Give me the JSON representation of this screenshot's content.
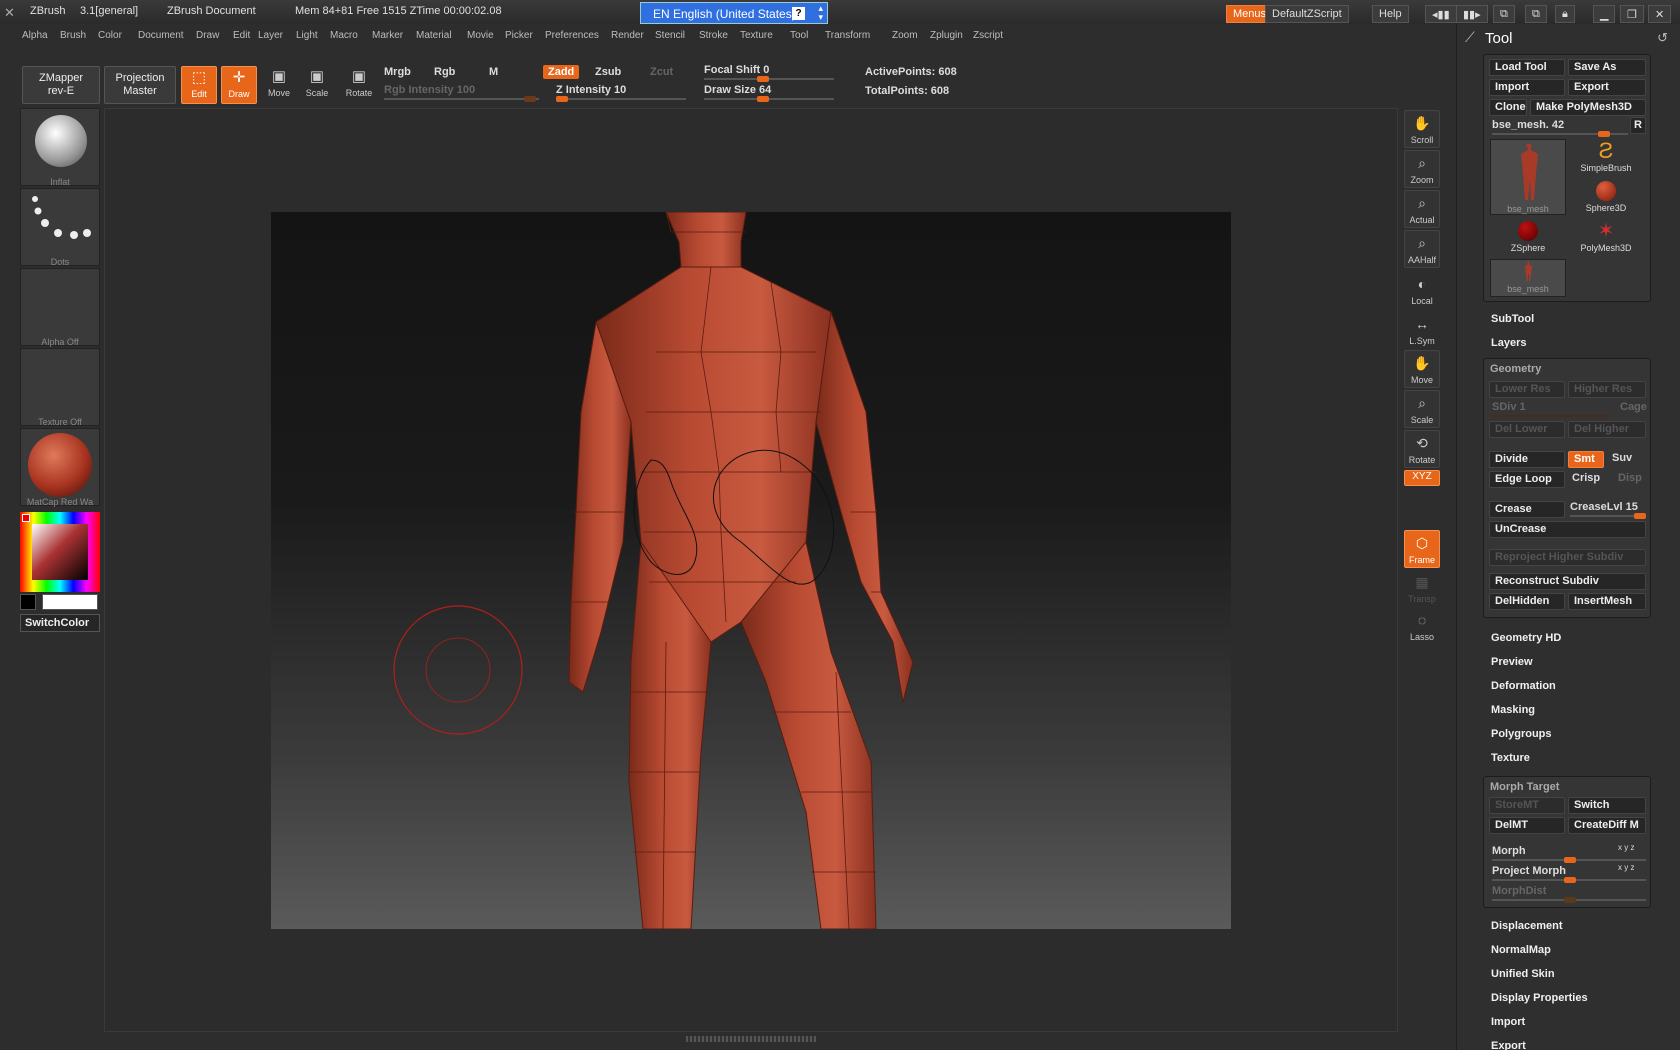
{
  "titlebar": {
    "app": "ZBrush",
    "version": "3.1[general]",
    "doc": "ZBrush Document",
    "stats": "Mem 84+81  Free 1515  ZTime 00:00:02.08",
    "lang": "EN English (United States)",
    "menus": "Menus",
    "script": "DefaultZScript",
    "help": "Help"
  },
  "menus": [
    "Alpha",
    "Brush",
    "Color",
    "Document",
    "Draw",
    "Edit",
    "Layer",
    "Light",
    "Macro",
    "Marker",
    "Material",
    "Movie",
    "Picker",
    "Preferences",
    "Render",
    "Stencil",
    "Stroke",
    "Texture",
    "Tool",
    "Transform",
    "Zoom",
    "Zplugin",
    "Zscript"
  ],
  "toolbar": {
    "zmapper": "ZMapper",
    "zmapper2": "rev-E",
    "projection": "Projection",
    "projection2": "Master",
    "edit": "Edit",
    "draw": "Draw",
    "move": "Move",
    "scale": "Scale",
    "rotate": "Rotate",
    "mrgb": "Mrgb",
    "rgb": "Rgb",
    "m": "M",
    "rgb_intensity": "Rgb Intensity 100",
    "zadd": "Zadd",
    "zsub": "Zsub",
    "zcut": "Zcut",
    "z_intensity": "Z Intensity 10",
    "focal_shift": "Focal Shift 0",
    "draw_size": "Draw Size 64",
    "active_points": "ActivePoints: 608",
    "total_points": "TotalPoints: 608",
    "focal_level": 0.45,
    "draw_level": 0.45
  },
  "leftbar": {
    "brush": "Inflat",
    "stroke": "Dots",
    "alpha": "Alpha Off",
    "texture": "Texture Off",
    "material": "MatCap Red Wa",
    "switch": "SwitchColor"
  },
  "rightstrip": [
    "Scroll",
    "Zoom",
    "Actual",
    "AAHalf",
    "Local",
    "L.Sym",
    "Move",
    "Scale",
    "Rotate",
    "XYZ",
    "Frame",
    "Transp",
    "Lasso"
  ],
  "panel": {
    "title": "Tool",
    "load": "Load Tool",
    "save": "Save As",
    "import": "Import",
    "export": "Export",
    "clone": "Clone",
    "make": "Make PolyMesh3D",
    "mesh_name": "bse_mesh. 42",
    "r": "R",
    "tools": [
      "bse_mesh",
      "SimpleBrush",
      "Sphere3D",
      "ZSphere",
      "PolyMesh3D",
      "bse_mesh"
    ],
    "subtool": "SubTool",
    "layers": "Layers",
    "geometry": "Geometry",
    "lower_res": "Lower Res",
    "higher_res": "Higher Res",
    "sdiv": "SDiv 1",
    "cage": "Cage",
    "del_lower": "Del Lower",
    "del_higher": "Del Higher",
    "divide": "Divide",
    "smt": "Smt",
    "suv": "Suv",
    "edge_loop": "Edge Loop",
    "crisp": "Crisp",
    "disp": "Disp",
    "crease": "Crease",
    "crease_lvl": "CreaseLvl 15",
    "uncrease": "UnCrease",
    "reproject": "Reproject Higher Subdiv",
    "reconstruct": "Reconstruct Subdiv",
    "delhidden": "DelHidden",
    "insertmesh": "InsertMesh",
    "sections": [
      "Geometry HD",
      "Preview",
      "Deformation",
      "Masking",
      "Polygroups",
      "Texture"
    ],
    "morph_target": "Morph Target",
    "storemt": "StoreMT",
    "switch": "Switch",
    "delmt": "DelMT",
    "creatediff": "CreateDiff M",
    "morph": "Morph",
    "project_morph": "Project Morph",
    "morphdist": "MorphDist",
    "xyz": "x y z",
    "sections2": [
      "Displacement",
      "NormalMap",
      "Unified Skin",
      "Display Properties",
      "Import",
      "Export"
    ]
  }
}
